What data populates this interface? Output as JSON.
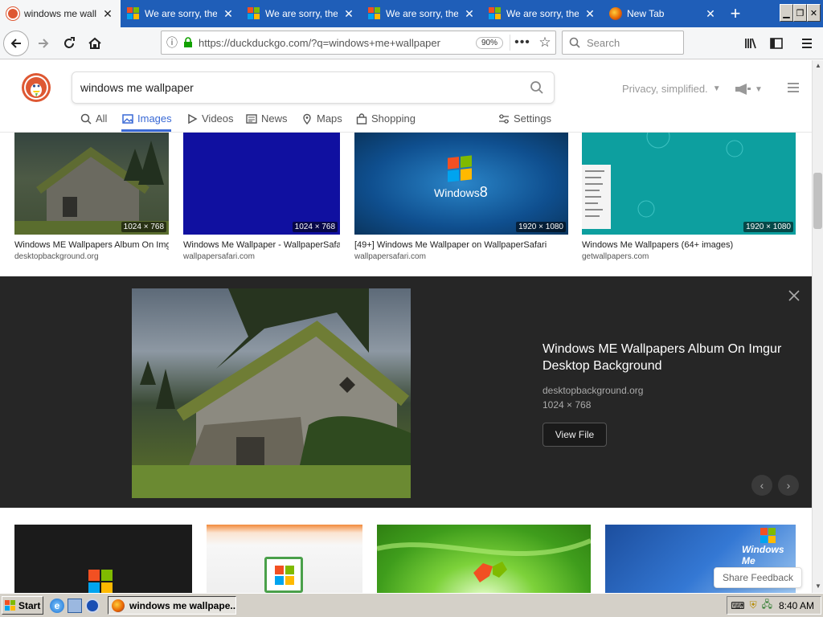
{
  "colors": {
    "tabstrip": "#1f5eb8",
    "ddg_orange": "#de5833",
    "accent_blue": "#3969d5",
    "detail_bg": "#262626"
  },
  "browser": {
    "tabs": [
      {
        "label": "windows me wallpaper",
        "icon": "duckduckgo-icon",
        "active": true
      },
      {
        "label": "We are sorry, the page",
        "icon": "microsoft-icon"
      },
      {
        "label": "We are sorry, the page",
        "icon": "microsoft-icon"
      },
      {
        "label": "We are sorry, the page",
        "icon": "microsoft-icon"
      },
      {
        "label": "We are sorry, the page",
        "icon": "microsoft-icon"
      },
      {
        "label": "New Tab",
        "icon": "firefox-icon"
      }
    ],
    "url": "https://duckduckgo.com/?q=windows+me+wallpaper",
    "zoom": "90%",
    "search_placeholder": "Search"
  },
  "ddg": {
    "query": "windows me wallpaper",
    "privacy_label": "Privacy, simplified.",
    "nav": [
      "All",
      "Images",
      "Videos",
      "News",
      "Maps",
      "Shopping"
    ],
    "settings_label": "Settings"
  },
  "results": [
    {
      "title": "Windows ME Wallpapers Album On Imgur Desktop Background",
      "source": "desktopbackground.org",
      "dims": "1024 × 768"
    },
    {
      "title": "Windows Me Wallpaper - WallpaperSafari",
      "source": "wallpapersafari.com",
      "dims": "1024 × 768"
    },
    {
      "title": "[49+] Windows Me Wallpaper on WallpaperSafari",
      "source": "wallpapersafari.com",
      "dims": "1920 × 1080"
    },
    {
      "title": "Windows Me Wallpapers (64+ images)",
      "source": "getwallpapers.com",
      "dims": "1920 × 1080"
    }
  ],
  "thumb_text": {
    "win8_logo": "Windows",
    "win8_number": "8",
    "winme_logo": "Windows Me"
  },
  "detail": {
    "title": "Windows ME Wallpapers Album On Imgur Desktop Background",
    "source": "desktopbackground.org",
    "dims": "1024 × 768",
    "view_label": "View File"
  },
  "share_feedback": "Share Feedback",
  "taskbar": {
    "start": "Start",
    "task": "windows me wallpape...",
    "clock": "8:40 AM"
  }
}
